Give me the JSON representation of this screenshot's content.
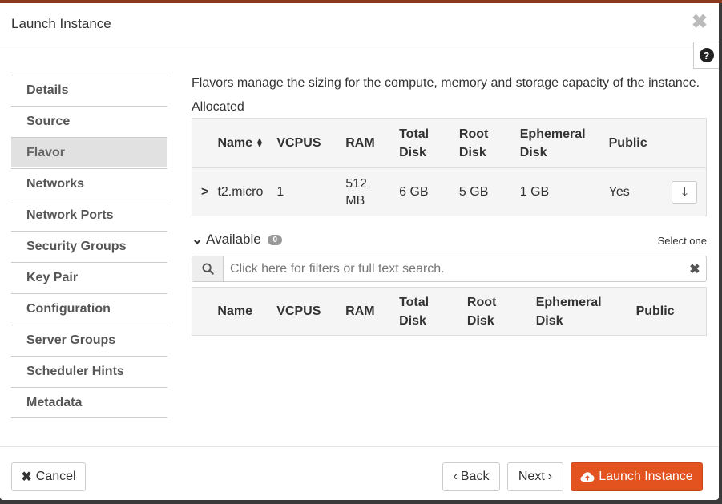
{
  "modal": {
    "title": "Launch Instance",
    "close_glyph": "✖",
    "help_glyph": "?"
  },
  "nav": {
    "items": [
      {
        "label": "Details"
      },
      {
        "label": "Source"
      },
      {
        "label": "Flavor"
      },
      {
        "label": "Networks"
      },
      {
        "label": "Network Ports"
      },
      {
        "label": "Security Groups"
      },
      {
        "label": "Key Pair"
      },
      {
        "label": "Configuration"
      },
      {
        "label": "Server Groups"
      },
      {
        "label": "Scheduler Hints"
      },
      {
        "label": "Metadata"
      }
    ],
    "active": "Flavor"
  },
  "content": {
    "intro": "Flavors manage the sizing for the compute, memory and storage capacity of the instance.",
    "allocated_label": "Allocated",
    "columns": {
      "name": "Name",
      "vcpus": "VCPUS",
      "ram": "RAM",
      "total_disk_1": "Total",
      "total_disk_2": "Disk",
      "root_disk_1": "Root",
      "root_disk_2": "Disk",
      "ephemeral_disk_1": "Ephemeral",
      "ephemeral_disk_2": "Disk",
      "public": "Public"
    },
    "allocated_rows": [
      {
        "name": "t2.micro",
        "vcpus": "1",
        "ram_1": "512",
        "ram_2": "MB",
        "total_disk": "6 GB",
        "root_disk": "5 GB",
        "ephemeral_disk": "1 GB",
        "public": "Yes"
      }
    ],
    "available_label": "Available",
    "available_count": "0",
    "select_one": "Select one",
    "search": {
      "placeholder": "Click here for filters or full text search."
    }
  },
  "footer": {
    "cancel_label": "Cancel",
    "back_label": "Back",
    "next_label": "Next",
    "launch_label": "Launch Instance"
  },
  "colors": {
    "accent": "#e2531f",
    "active_nav_bg": "#e1e1e1",
    "table_header_bg": "#f5f5f5"
  },
  "icons": [
    "close-icon",
    "help-icon",
    "sort-icon",
    "chevron-right-icon",
    "arrow-down-icon",
    "chevron-down-icon",
    "search-icon",
    "clear-icon",
    "times-icon",
    "chevron-left-icon",
    "cloud-upload-icon"
  ]
}
